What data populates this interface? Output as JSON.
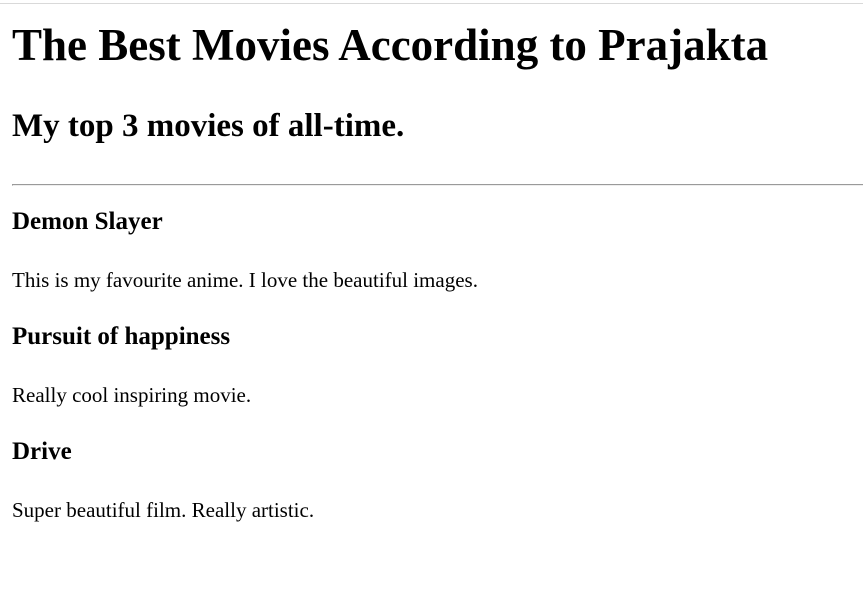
{
  "page": {
    "title": "The Best Movies According to Prajakta",
    "subtitle": "My top 3 movies of all-time."
  },
  "movies": [
    {
      "title": "Demon Slayer",
      "description": "This is my favourite anime. I love the beautiful images."
    },
    {
      "title": "Pursuit of happiness",
      "description": "Really cool inspiring movie."
    },
    {
      "title": "Drive",
      "description": "Super beautiful film. Really artistic."
    }
  ]
}
